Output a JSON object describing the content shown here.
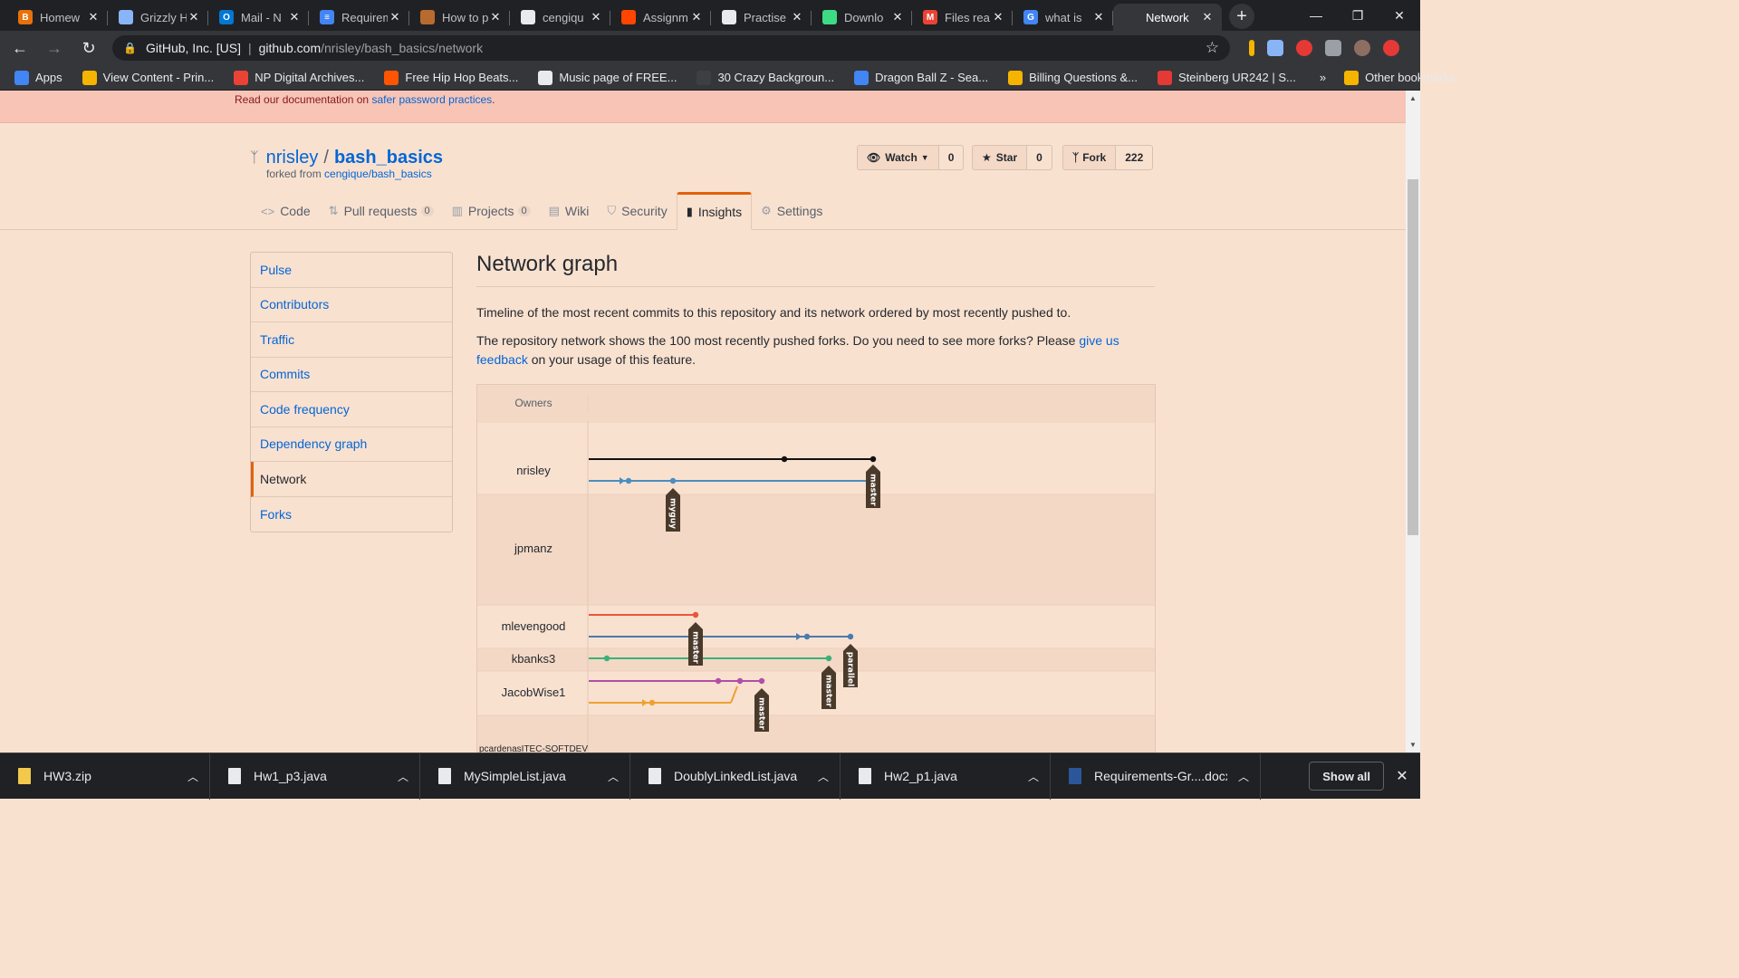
{
  "browser": {
    "tabs": [
      {
        "title": "Homew",
        "favicon_color": "#e8710a",
        "favicon_letter": "B"
      },
      {
        "title": "Grizzly H",
        "favicon_color": "#8ab4f8",
        "favicon_letter": ""
      },
      {
        "title": "Mail - N",
        "favicon_color": "#0078d4",
        "favicon_letter": "O"
      },
      {
        "title": "Requirem",
        "favicon_color": "#4285f4",
        "favicon_letter": "≡"
      },
      {
        "title": "How to p",
        "favicon_color": "#b86b2f",
        "favicon_letter": ""
      },
      {
        "title": "cengiqu",
        "favicon_color": "#e8eaed",
        "favicon_letter": ""
      },
      {
        "title": "Assignm",
        "favicon_color": "#ff4500",
        "favicon_letter": ""
      },
      {
        "title": "Practise",
        "favicon_color": "#e8eaed",
        "favicon_letter": ""
      },
      {
        "title": "Downlo",
        "favicon_color": "#3ddc84",
        "favicon_letter": ""
      },
      {
        "title": "Files rea",
        "favicon_color": "#ea4335",
        "favicon_letter": "M"
      },
      {
        "title": "what is",
        "favicon_color": "#4285f4",
        "favicon_letter": "G"
      },
      {
        "title": "Network",
        "favicon_color": "#35363a",
        "favicon_letter": ""
      }
    ],
    "address": {
      "org": "GitHub, Inc. [US]",
      "host": "github.com",
      "path": "/nrisley/bash_basics/network"
    },
    "bookmarks": [
      {
        "label": "Apps",
        "color": "#4285f4"
      },
      {
        "label": "View Content - Prin...",
        "color": "#f4b400"
      },
      {
        "label": "NP Digital Archives...",
        "color": "#ea4335"
      },
      {
        "label": "Free Hip Hop Beats...",
        "color": "#ff5500"
      },
      {
        "label": "Music page of FREE...",
        "color": "#e8eaed"
      },
      {
        "label": "30 Crazy Backgroun...",
        "color": "#3c4043"
      },
      {
        "label": "Dragon Ball Z - Sea...",
        "color": "#4285f4"
      },
      {
        "label": "Billing Questions &...",
        "color": "#f4b400"
      },
      {
        "label": "Steinberg UR242 | S...",
        "color": "#e53935"
      }
    ],
    "bookmarks_more": "»",
    "other_bookmarks": "Other bookmarks"
  },
  "flash": {
    "text_before": "Read our documentation on ",
    "link": "safer password practices",
    "text_after": "."
  },
  "repo": {
    "owner": "nrisley",
    "name": "bash_basics",
    "forked_label": "forked from ",
    "forked_from": "cengique/bash_basics",
    "watch_label": "Watch",
    "watch_count": "0",
    "star_label": "Star",
    "star_count": "0",
    "fork_label": "Fork",
    "fork_count": "222"
  },
  "tabs": [
    {
      "label": "Code",
      "icon": "code-icon",
      "glyph": "<>",
      "badge": ""
    },
    {
      "label": "Pull requests",
      "icon": "pull-request-icon",
      "glyph": "⇅",
      "badge": "0"
    },
    {
      "label": "Projects",
      "icon": "project-icon",
      "glyph": "▥",
      "badge": "0"
    },
    {
      "label": "Wiki",
      "icon": "book-icon",
      "glyph": "▤",
      "badge": ""
    },
    {
      "label": "Security",
      "icon": "shield-icon",
      "glyph": "⛉",
      "badge": ""
    },
    {
      "label": "Insights",
      "icon": "graph-icon",
      "glyph": "▮",
      "badge": "",
      "selected": true
    },
    {
      "label": "Settings",
      "icon": "gear-icon",
      "glyph": "⚙",
      "badge": ""
    }
  ],
  "sidebar": {
    "items": [
      {
        "label": "Pulse"
      },
      {
        "label": "Contributors"
      },
      {
        "label": "Traffic"
      },
      {
        "label": "Commits"
      },
      {
        "label": "Code frequency"
      },
      {
        "label": "Dependency graph"
      },
      {
        "label": "Network",
        "selected": true
      },
      {
        "label": "Forks"
      }
    ]
  },
  "main": {
    "title": "Network graph",
    "desc1": "Timeline of the most recent commits to this repository and its network ordered by most recently pushed to.",
    "desc2_before": "The repository network shows the 100 most recently pushed forks. Do you need to see more forks? Please ",
    "desc2_link": "give us feedback",
    "desc2_after": " on your usage of this feature."
  },
  "network": {
    "owners_header": "Owners",
    "owners": [
      "nrisley",
      "jpmanz",
      "mlevengood",
      "kbanks3",
      "JacobWise1",
      "pcardenasITEC-SOFTDEV"
    ],
    "branch_labels": [
      "myguy",
      "master",
      "master",
      "parallel",
      "master",
      "master"
    ],
    "colors": {
      "black": "#111111",
      "blue": "#4a8ec2",
      "red": "#e8563c",
      "steel": "#4a7bb0",
      "green": "#3ab17a",
      "purple": "#b04fa8",
      "orange": "#f0a030",
      "label_bg": "#4a3a2a"
    }
  },
  "downloads": {
    "items": [
      {
        "name": "HW3.zip",
        "type": "zip"
      },
      {
        "name": "Hw1_p3.java",
        "type": "file"
      },
      {
        "name": "MySimpleList.java",
        "type": "file"
      },
      {
        "name": "DoublyLinkedList.java",
        "type": "file"
      },
      {
        "name": "Hw2_p1.java",
        "type": "file"
      },
      {
        "name": "Requirements-Gr....docx",
        "type": "word"
      }
    ],
    "show_all": "Show all"
  }
}
